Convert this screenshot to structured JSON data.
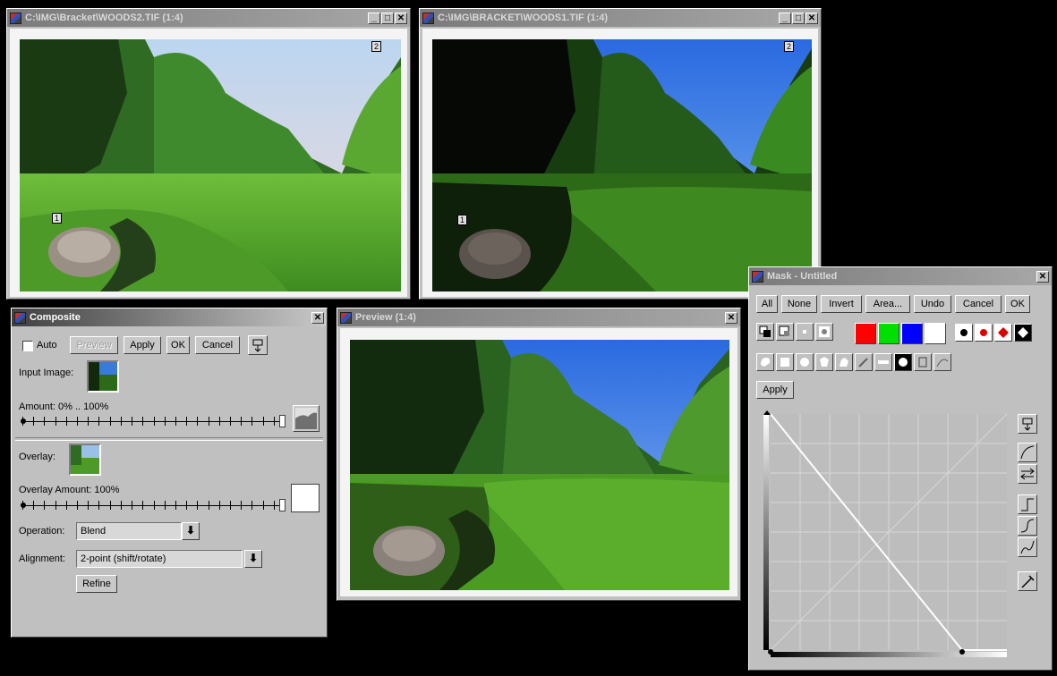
{
  "windows": {
    "woods2": {
      "title": "C:\\IMG\\Bracket\\WOODS2.TIF (1:4)",
      "marker_top": "2",
      "marker_bottom": "1"
    },
    "woods1": {
      "title": "C:\\IMG\\BRACKET\\WOODS1.TIF (1:4)",
      "marker_top": "2",
      "marker_bottom": "1"
    },
    "preview": {
      "title": "Preview (1:4)"
    }
  },
  "composite": {
    "title": "Composite",
    "auto_label": "Auto",
    "auto_checked": false,
    "preview_button": "Preview",
    "apply_button": "Apply",
    "ok_button": "OK",
    "cancel_button": "Cancel",
    "input_image_label": "Input Image:",
    "amount_label": "Amount: 0% .. 100%",
    "amount_value_percent": 100,
    "overlay_label": "Overlay:",
    "overlay_amount_label": "Overlay Amount: 100%",
    "overlay_amount_percent": 100,
    "operation_label": "Operation:",
    "operation_value": "Blend",
    "alignment_label": "Alignment:",
    "alignment_value": "2-point (shift/rotate)",
    "refine_button": "Refine"
  },
  "mask": {
    "title": "Mask - Untitled",
    "buttons": {
      "all": "All",
      "none": "None",
      "invert": "Invert",
      "area": "Area...",
      "undo": "Undo",
      "cancel": "Cancel",
      "ok": "OK",
      "apply": "Apply"
    },
    "colors": {
      "red": "#ff0000",
      "green": "#00e000",
      "blue": "#0000ff",
      "white": "#ffffff"
    }
  },
  "colors": {
    "desktop": "#000000",
    "window_face": "#c0c0c0",
    "curve_bg": "#bdbdbd",
    "curve_line": "#ffffff"
  }
}
